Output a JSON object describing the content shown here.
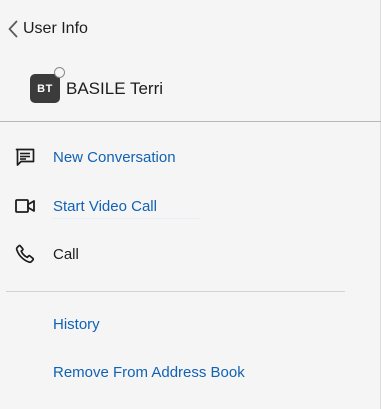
{
  "header": {
    "title": "User Info"
  },
  "user": {
    "initials": "BT",
    "name": "BASILE Terri",
    "presence": "offline"
  },
  "actions": [
    {
      "label": "New Conversation",
      "icon": "chat-icon"
    },
    {
      "label": "Start Video Call",
      "icon": "video-camera-icon"
    },
    {
      "label": "Call",
      "icon": "phone-icon"
    }
  ],
  "links": [
    {
      "label": "History"
    },
    {
      "label": "Remove From Address Book"
    }
  ],
  "colors": {
    "link": "#1162b4",
    "text": "#1d1d1d",
    "background": "#f5f5f5",
    "avatar": "#3b3b3b"
  }
}
